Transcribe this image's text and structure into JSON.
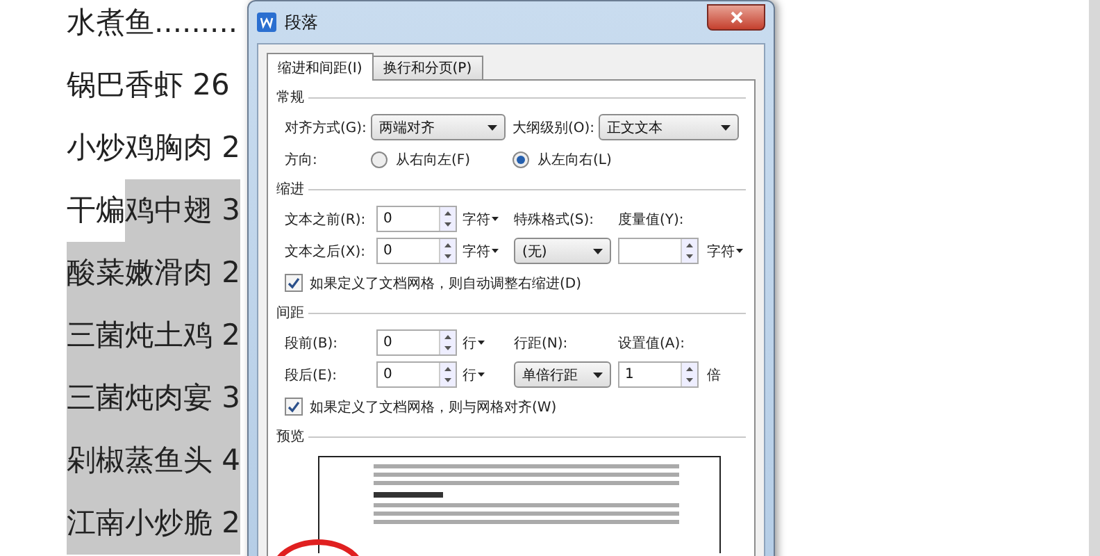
{
  "document": {
    "lines": [
      {
        "segments": [
          {
            "text": "水煮鱼.........",
            "selected": false
          }
        ]
      },
      {
        "segments": [
          {
            "text": "锅巴香虾 26",
            "selected": false
          }
        ]
      },
      {
        "segments": [
          {
            "text": "小炒鸡胸肉 2",
            "selected": false
          }
        ]
      },
      {
        "segments": [
          {
            "text": "干煸",
            "selected": false
          },
          {
            "text": "鸡中翅 3",
            "selected": true
          }
        ]
      },
      {
        "segments": [
          {
            "text": "酸菜嫩滑肉 2",
            "selected": true
          }
        ]
      },
      {
        "segments": [
          {
            "text": "三菌炖土鸡 2",
            "selected": true
          }
        ]
      },
      {
        "segments": [
          {
            "text": "三菌炖肉宴 3",
            "selected": true
          }
        ]
      },
      {
        "segments": [
          {
            "text": "剁椒蒸鱼头 4",
            "selected": true
          }
        ]
      },
      {
        "segments": [
          {
            "text": "江南小炒脆 2",
            "selected": true
          }
        ]
      }
    ]
  },
  "dialog": {
    "title": "段落",
    "tabs": [
      {
        "label": "缩进和间距(I)",
        "selected": true
      },
      {
        "label": "换行和分页(P)",
        "selected": false
      }
    ],
    "sections": [
      {
        "title": "常规",
        "rows": [
          {
            "kind": "pair",
            "cells": [
              {
                "kind": "label",
                "text": "对齐方式(G):"
              },
              {
                "kind": "select",
                "value": "两端对齐"
              },
              {
                "kind": "label",
                "text": "大纲级别(O):"
              },
              {
                "kind": "select",
                "value": "正文文本"
              }
            ]
          },
          {
            "kind": "pair",
            "cells": [
              {
                "kind": "label",
                "text": "方向:"
              },
              {
                "kind": "radio",
                "text": "从右向左(F)",
                "selected": false
              },
              {
                "kind": "radio",
                "text": "从左向右(L)",
                "selected": true
              }
            ]
          }
        ]
      },
      {
        "title": "缩进",
        "rows": [
          {
            "kind": "grid",
            "cells": [
              {
                "kind": "label",
                "text": "文本之前(R):"
              },
              {
                "kind": "spin",
                "value": "0"
              },
              {
                "kind": "unit",
                "text": "字符",
                "dropdown": true
              },
              {
                "kind": "label",
                "text": "特殊格式(S):"
              },
              {
                "kind": "label",
                "text": "度量值(Y):"
              }
            ]
          },
          {
            "kind": "grid",
            "cells": [
              {
                "kind": "label",
                "text": "文本之后(X):"
              },
              {
                "kind": "spin",
                "value": "0"
              },
              {
                "kind": "unit",
                "text": "字符",
                "dropdown": true
              },
              {
                "kind": "select",
                "value": "(无)"
              },
              {
                "kind": "spin"
              },
              {
                "kind": "unit",
                "text": "字符",
                "dropdown": true
              }
            ]
          }
        ],
        "checkbox": {
          "label": "如果定义了文档网格，则自动调整右缩进(D)",
          "checked": true
        }
      },
      {
        "title": "间距",
        "rows": [
          {
            "kind": "grid",
            "cells": [
              {
                "kind": "label",
                "text": "段前(B):"
              },
              {
                "kind": "spin",
                "value": "0"
              },
              {
                "kind": "unit",
                "text": "行",
                "dropdown": true
              },
              {
                "kind": "label",
                "text": "行距(N):"
              },
              {
                "kind": "label",
                "text": "设置值(A):"
              }
            ]
          },
          {
            "kind": "grid",
            "cells": [
              {
                "kind": "label",
                "text": "段后(E):"
              },
              {
                "kind": "spin",
                "value": "0"
              },
              {
                "kind": "unit",
                "text": "行",
                "dropdown": true
              },
              {
                "kind": "select",
                "value": "单倍行距"
              },
              {
                "kind": "spin",
                "value": "1"
              },
              {
                "kind": "unit",
                "text": "倍",
                "dropdown": false
              }
            ]
          }
        ],
        "checkbox": {
          "label": "如果定义了文档网格，则与网格对齐(W)",
          "checked": true
        }
      }
    ],
    "preview": {
      "title": "预览"
    }
  }
}
